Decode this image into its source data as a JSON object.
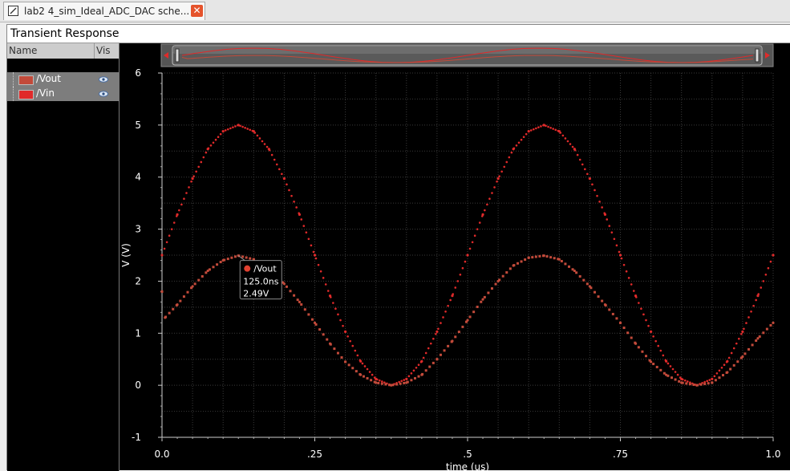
{
  "tab": {
    "title": "lab2 4_sim_Ideal_ADC_DAC sche...",
    "close_icon": "close-icon"
  },
  "window": {
    "title": "Transient Response"
  },
  "legend": {
    "header_name": "Name",
    "header_vis": "Vis",
    "items": [
      {
        "label": "/Vout",
        "color": "#c24a3a",
        "visible": true
      },
      {
        "label": "/Vin",
        "color": "#e02a2a",
        "visible": true
      }
    ]
  },
  "marker": {
    "trace": "/Vout",
    "time": "125.0ns",
    "value": "2.49V"
  },
  "colors": {
    "background": "#000000",
    "grid": "#3a3a3a",
    "axis_text": "#ffffff",
    "vout": "#c24a3a",
    "vin": "#e02a2a"
  },
  "chart_data": {
    "type": "scatter",
    "title": "",
    "xlabel": "time (us)",
    "ylabel": "V (V)",
    "xlim": [
      0,
      1
    ],
    "ylim": [
      -1,
      6
    ],
    "xticks": [
      0.0,
      0.25,
      0.5,
      0.75,
      1.0
    ],
    "xtick_labels": [
      "0.0",
      ".25",
      ".5",
      ".75",
      "1.0"
    ],
    "yticks": [
      -1,
      0,
      1,
      2,
      3,
      4,
      5,
      6
    ],
    "ytick_labels": [
      "-1",
      "0",
      "1",
      "2",
      "3",
      "4",
      "5",
      "6"
    ],
    "grid": true,
    "series": [
      {
        "name": "/Vin",
        "color": "#e02a2a",
        "x": [
          0,
          0.025,
          0.05,
          0.075,
          0.1,
          0.125,
          0.15,
          0.175,
          0.2,
          0.225,
          0.25,
          0.275,
          0.3,
          0.325,
          0.35,
          0.375,
          0.4,
          0.425,
          0.45,
          0.475,
          0.5,
          0.525,
          0.55,
          0.575,
          0.6,
          0.625,
          0.65,
          0.675,
          0.7,
          0.725,
          0.75,
          0.775,
          0.8,
          0.825,
          0.85,
          0.875,
          0.9,
          0.925,
          0.95,
          0.975,
          1.0
        ],
        "y": [
          2.5,
          3.28,
          3.97,
          4.54,
          4.88,
          5.0,
          4.88,
          4.54,
          3.97,
          3.28,
          2.5,
          1.72,
          1.03,
          0.46,
          0.12,
          0.0,
          0.12,
          0.46,
          1.03,
          1.72,
          2.5,
          3.28,
          3.97,
          4.54,
          4.88,
          5.0,
          4.88,
          4.54,
          3.97,
          3.28,
          2.5,
          1.72,
          1.03,
          0.46,
          0.12,
          0.0,
          0.12,
          0.46,
          1.03,
          1.72,
          2.5
        ]
      },
      {
        "name": "/Vout",
        "color": "#c24a3a",
        "x": [
          0,
          0.005,
          0.025,
          0.05,
          0.075,
          0.1,
          0.125,
          0.15,
          0.175,
          0.2,
          0.225,
          0.25,
          0.275,
          0.3,
          0.325,
          0.35,
          0.375,
          0.4,
          0.425,
          0.45,
          0.475,
          0.5,
          0.525,
          0.55,
          0.575,
          0.6,
          0.625,
          0.65,
          0.675,
          0.7,
          0.725,
          0.75,
          0.775,
          0.8,
          0.825,
          0.85,
          0.875,
          0.9,
          0.925,
          0.95,
          0.975,
          1.0
        ],
        "y": [
          1.8,
          1.3,
          1.55,
          1.9,
          2.2,
          2.4,
          2.49,
          2.42,
          2.25,
          1.95,
          1.6,
          1.2,
          0.8,
          0.45,
          0.2,
          0.05,
          0.0,
          0.05,
          0.2,
          0.5,
          0.85,
          1.25,
          1.65,
          2.0,
          2.3,
          2.45,
          2.49,
          2.42,
          2.2,
          1.9,
          1.55,
          1.2,
          0.8,
          0.45,
          0.2,
          0.05,
          0.0,
          0.05,
          0.25,
          0.55,
          0.9,
          1.2
        ]
      }
    ],
    "annotations": [
      {
        "series": "/Vout",
        "x": 0.125,
        "y": 2.49,
        "text": [
          "/Vout",
          "125.0ns",
          "2.49V"
        ]
      }
    ]
  }
}
